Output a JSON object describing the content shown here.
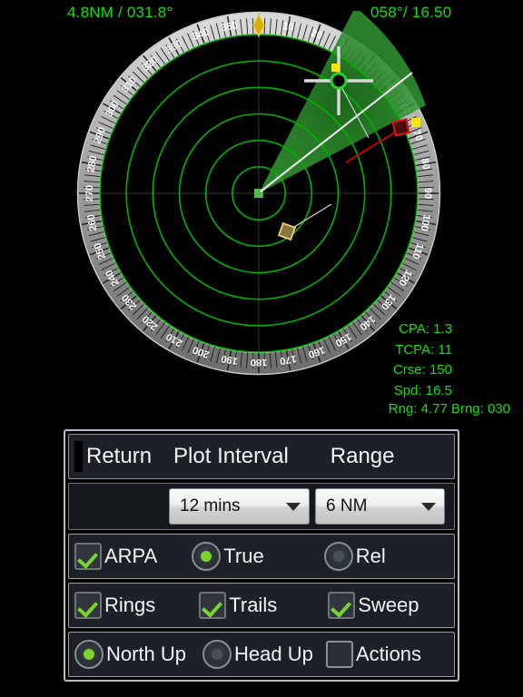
{
  "top": {
    "cursor_readout": "4.8NM / 031.8°",
    "own_readout": "058°/ 16.50"
  },
  "target_data": {
    "cpa": "CPA: 1.3",
    "tcpa": "TCPA: 11",
    "crse": "Crse: 150",
    "spd": "Spd: 16.5",
    "rng_brng": "Rng: 4.77 Brng: 030"
  },
  "radar": {
    "heading_marker_label": "0",
    "compass_labels": [
      "0",
      "10",
      "20",
      "30",
      "40",
      "50",
      "60",
      "70",
      "80",
      "90",
      "100",
      "110",
      "120",
      "130",
      "140",
      "150",
      "160",
      "170",
      "180",
      "190",
      "200",
      "210",
      "220",
      "230",
      "240",
      "250",
      "260",
      "270",
      "280",
      "290",
      "300",
      "310",
      "320",
      "330",
      "340",
      "350"
    ],
    "ring_count": 6,
    "colors": {
      "ring": "#00b200",
      "sweep": "#2f8f2f",
      "own_ship": "#4dbb4d",
      "target_alarm": "#cc0000",
      "target_plain": "#b39b63",
      "cursor": "#d8d8d8",
      "accent_green": "#13e013"
    }
  },
  "panel": {
    "header": {
      "return_label": "Return",
      "plot_interval_label": "Plot Interval",
      "range_label": "Range"
    },
    "selectors": {
      "plot_interval_value": "12 mins",
      "range_value": "6 NM"
    },
    "options_row1": [
      {
        "label": "ARPA",
        "type": "checkbox",
        "checked": true
      },
      {
        "label": "True",
        "type": "radio",
        "selected": true
      },
      {
        "label": "Rel",
        "type": "radio",
        "selected": false
      }
    ],
    "options_row2": [
      {
        "label": "Rings",
        "type": "checkbox",
        "checked": true
      },
      {
        "label": "Trails",
        "type": "checkbox",
        "checked": true
      },
      {
        "label": "Sweep",
        "type": "checkbox",
        "checked": true
      }
    ],
    "options_row3": [
      {
        "label": "North Up",
        "type": "radio",
        "selected": true
      },
      {
        "label": "Head Up",
        "type": "radio",
        "selected": false
      },
      {
        "label": "Actions",
        "type": "checkbox",
        "checked": false
      }
    ]
  }
}
